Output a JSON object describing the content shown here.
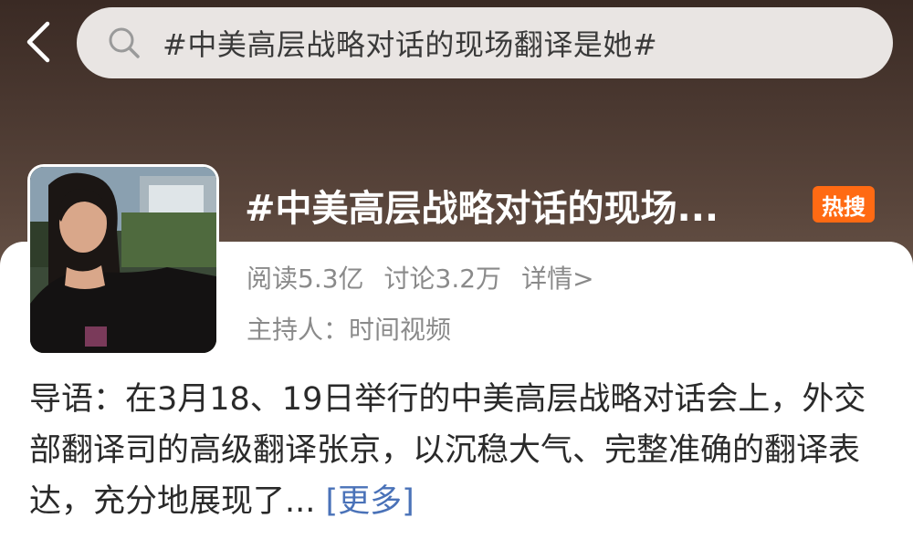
{
  "search": {
    "query": "#中美高层战略对话的现场翻译是她#"
  },
  "topic": {
    "title": "#中美高层战略对话的现场...",
    "hot_badge": "热搜",
    "reads": "阅读5.3亿",
    "discussions": "讨论3.2万",
    "details_link": "详情>",
    "host": "主持人：时间视频"
  },
  "intro": {
    "text": "导语：在3月18、19日举行的中美高层战略对话会上，外交部翻译司的高级翻译张京，以沉稳大气、完整准确的翻译表达，充分地展现了...",
    "more_link": "[更多]"
  },
  "colors": {
    "badge": "#ff6a13",
    "link": "#4a72b8"
  }
}
